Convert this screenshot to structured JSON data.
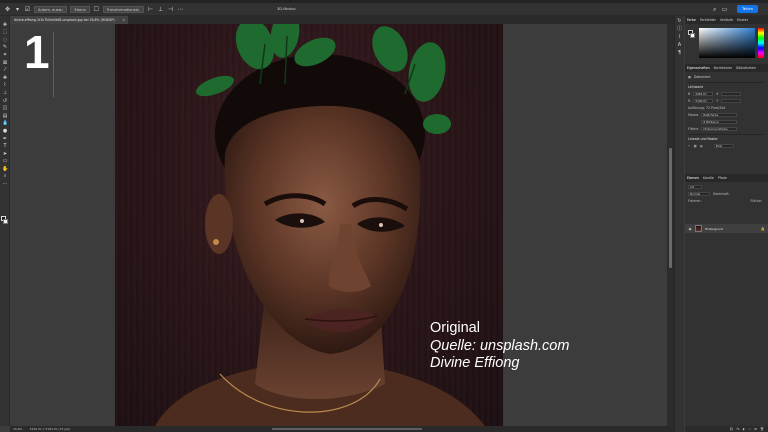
{
  "options_bar": {
    "move_tool_icon": "move-icon",
    "auto_select_label": "Autom. ausw.:",
    "layer_option": "Ebene",
    "transform_label": "Transformationsst.",
    "mode_3d": "3D-Modus:",
    "share_label": "Teilen"
  },
  "document_tab": {
    "title": "divine-effiong-1t1h7k0ek5bf8-unsplash.jpg bei 16,6% (RGB/8*)",
    "close_glyph": "×"
  },
  "canvas": {
    "overlay_number": "1",
    "caption_lines": [
      "Original",
      "Quelle: unsplash.com",
      "Divine Effiong"
    ],
    "accent_color": "#2d6ea8"
  },
  "status_bar": {
    "zoom": "16,6%",
    "doc_info": "3456 Px x 5184 Px (72 ppi)"
  },
  "color_panel": {
    "tabs": [
      "Farbe",
      "Farbfelder",
      "Verläufe",
      "Muster"
    ],
    "foreground": "#1a1a1a",
    "background": "#ffffff"
  },
  "properties_panel": {
    "tabs": [
      "Eigenschaften",
      "Korrekturen",
      "Bibliotheken"
    ],
    "doc_type": "Dokument",
    "canvas_header": "Leinwand",
    "width_label": "B",
    "width_value": "3456 Px",
    "height_label": "H",
    "height_value": "5184 Px",
    "x_label": "X",
    "y_label": "Y",
    "resolution": "Auflösung: 72 Pixel/Zoll",
    "mode_label": "Modus",
    "mode_value": "RGB-Farbe",
    "depth_value": "8 Bit/Kanal",
    "fill_label": "Fläche",
    "fill_value": "Hintergrundfarbe",
    "rulers_header": "Lineale und Raster",
    "unit_value": "Pixel"
  },
  "layers_panel": {
    "tabs": [
      "Ebenen",
      "Kanäle",
      "Pfade"
    ],
    "kind_label": "Art",
    "normal_label": "Normal",
    "opacity_label": "Deckkraft:",
    "lock_label": "Fixieren:",
    "fill_label": "Fläche:",
    "layer_name": "Hintergrund"
  }
}
